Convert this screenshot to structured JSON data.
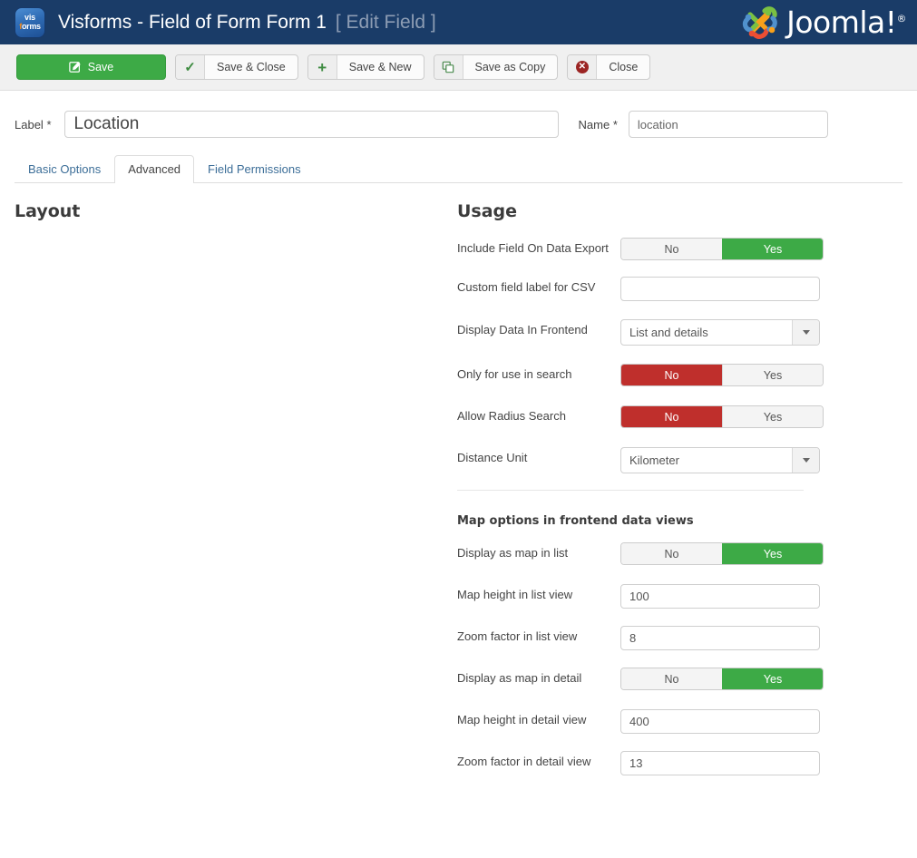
{
  "header": {
    "logo_alt": "visforms-logo",
    "logo_line1": "vis",
    "logo_line2_o": "f",
    "logo_line2_rest": "orms",
    "title": "Visforms - Field of Form Form 1",
    "subtitle": "[ Edit Field ]",
    "brand": "Joomla!",
    "brand_reg": "®"
  },
  "toolbar": {
    "save_label": "Save",
    "save_close_label": "Save & Close",
    "save_new_label": "Save & New",
    "save_copy_label": "Save as Copy",
    "close_label": "Close"
  },
  "title_row": {
    "label_label": "Label",
    "label_required": "*",
    "label_value": "Location",
    "label_placeholder": "",
    "name_label": "Name",
    "name_required": "*",
    "name_value": "location",
    "name_placeholder": ""
  },
  "tabs": [
    {
      "label": "Basic Options",
      "active": false
    },
    {
      "label": "Advanced",
      "active": true
    },
    {
      "label": "Field Permissions",
      "active": false
    }
  ],
  "left_column": {
    "heading": "Layout"
  },
  "usage": {
    "heading": "Usage",
    "fields": [
      {
        "label": "Include Field On Data Export",
        "type": "toggle",
        "options": [
          "No",
          "Yes"
        ],
        "value": "Yes",
        "state": "yes"
      },
      {
        "label": "Custom field label for CSV",
        "type": "text",
        "value": "",
        "placeholder": ""
      },
      {
        "label": "Display Data In Frontend",
        "type": "select",
        "value": "List and details"
      },
      {
        "label": "Only for use in search",
        "type": "toggle",
        "options": [
          "No",
          "Yes"
        ],
        "value": "No",
        "state": "no"
      },
      {
        "label": "Allow Radius Search",
        "type": "toggle",
        "options": [
          "No",
          "Yes"
        ],
        "value": "No",
        "state": "no"
      },
      {
        "label": "Distance Unit",
        "type": "select",
        "value": "Kilometer"
      }
    ]
  },
  "map_options": {
    "heading": "Map options in frontend data views",
    "fields": [
      {
        "label": "Display as map in list",
        "type": "toggle",
        "options": [
          "No",
          "Yes"
        ],
        "value": "Yes",
        "state": "yes"
      },
      {
        "label": "Map height in list view",
        "type": "text",
        "value": "100",
        "placeholder": ""
      },
      {
        "label": "Zoom factor in list view",
        "type": "text",
        "value": "8",
        "placeholder": ""
      },
      {
        "label": "Display as map in detail",
        "type": "toggle",
        "options": [
          "No",
          "Yes"
        ],
        "value": "Yes",
        "state": "yes"
      },
      {
        "label": "Map height in detail view",
        "type": "text",
        "value": "400",
        "placeholder": ""
      },
      {
        "label": "Zoom factor in detail view",
        "type": "text",
        "value": "13",
        "placeholder": ""
      }
    ]
  },
  "colors": {
    "header_bg": "#1a3c68",
    "green": "#3daa46",
    "red": "#bf2f2c",
    "toolbar_bg": "#f0f0f0",
    "tab_link": "#3c6e98"
  }
}
